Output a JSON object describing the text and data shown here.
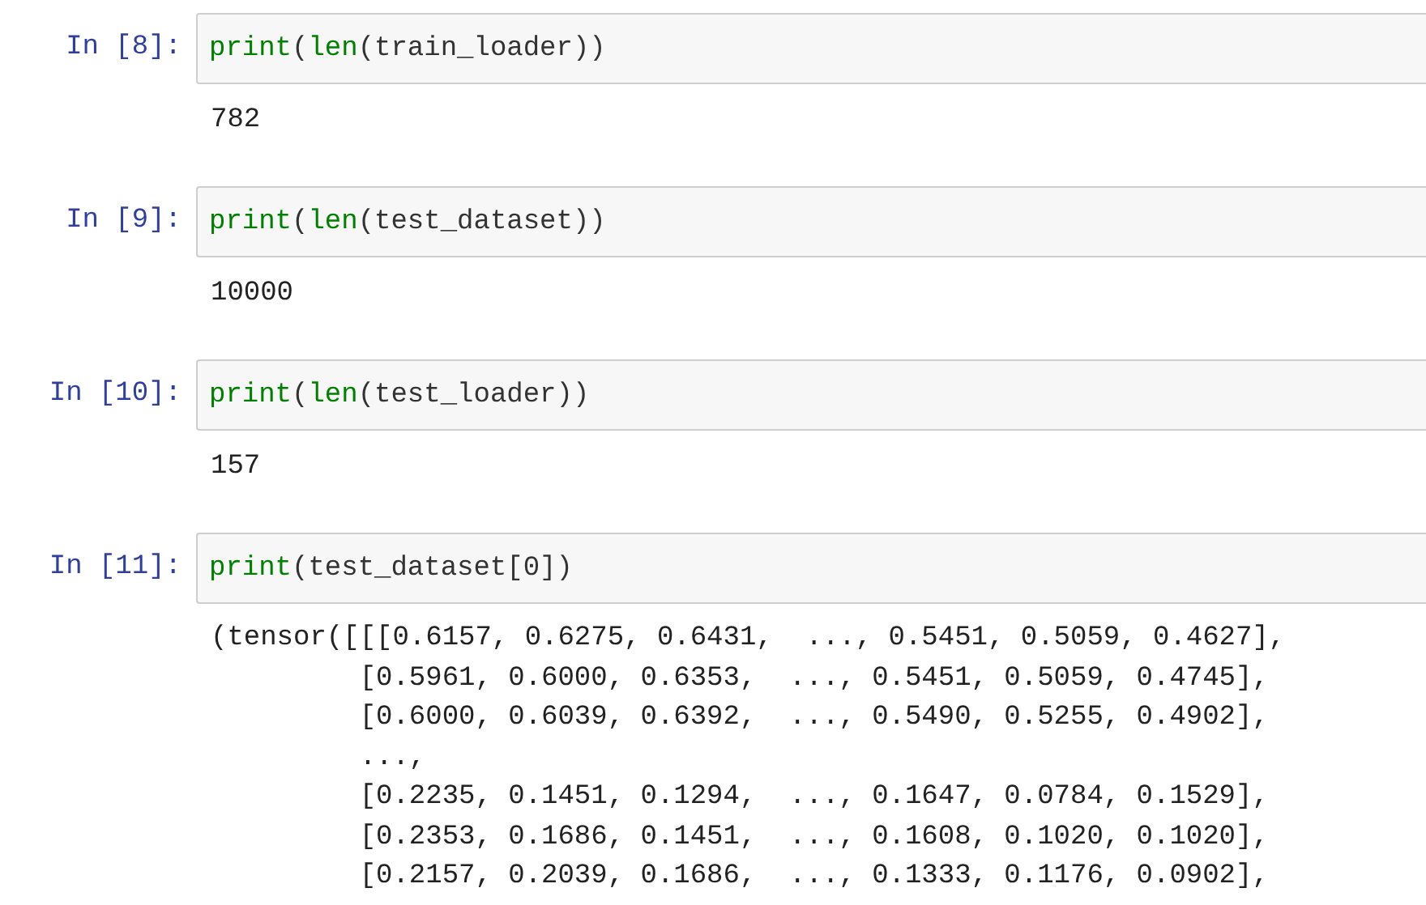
{
  "cells": [
    {
      "prompt": "In [8]:",
      "code": [
        {
          "kind": "builtin",
          "text": "print"
        },
        {
          "kind": "plain",
          "text": "("
        },
        {
          "kind": "builtin",
          "text": "len"
        },
        {
          "kind": "plain",
          "text": "(train_loader))"
        }
      ],
      "output": [
        "782"
      ]
    },
    {
      "prompt": "In [9]:",
      "code": [
        {
          "kind": "builtin",
          "text": "print"
        },
        {
          "kind": "plain",
          "text": "("
        },
        {
          "kind": "builtin",
          "text": "len"
        },
        {
          "kind": "plain",
          "text": "(test_dataset))"
        }
      ],
      "output": [
        "10000"
      ]
    },
    {
      "prompt": "In [10]:",
      "code": [
        {
          "kind": "builtin",
          "text": "print"
        },
        {
          "kind": "plain",
          "text": "("
        },
        {
          "kind": "builtin",
          "text": "len"
        },
        {
          "kind": "plain",
          "text": "(test_loader))"
        }
      ],
      "output": [
        "157"
      ]
    },
    {
      "prompt": "In [11]:",
      "code": [
        {
          "kind": "builtin",
          "text": "print"
        },
        {
          "kind": "plain",
          "text": "(test_dataset[0])"
        }
      ],
      "output": [
        "(tensor([[[0.6157, 0.6275, 0.6431,  ..., 0.5451, 0.5059, 0.4627],",
        "         [0.5961, 0.6000, 0.6353,  ..., 0.5451, 0.5059, 0.4745],",
        "         [0.6000, 0.6039, 0.6392,  ..., 0.5490, 0.5255, 0.4902],",
        "         ...,",
        "         [0.2235, 0.1451, 0.1294,  ..., 0.1647, 0.0784, 0.1529],",
        "         [0.2353, 0.1686, 0.1451,  ..., 0.1608, 0.1020, 0.1020],",
        "         [0.2157, 0.2039, 0.1686,  ..., 0.1333, 0.1176, 0.0902],"
      ]
    }
  ]
}
